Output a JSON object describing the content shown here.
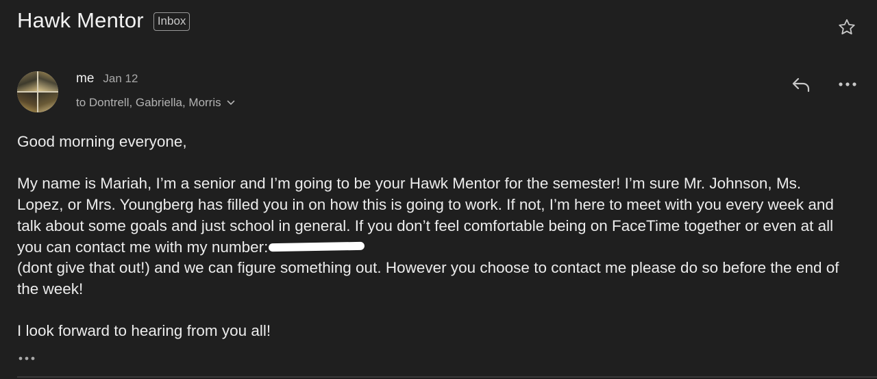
{
  "header": {
    "subject": "Hawk Mentor",
    "label": "Inbox",
    "star_icon": "star-outline-icon"
  },
  "message": {
    "sender": "me",
    "date": "Jan 12",
    "recipients": "to Dontrell, Gabriella, Morris",
    "avatar": "profile-photo-collage",
    "actions": {
      "reply_icon": "reply-icon",
      "more_icon": "more-horizontal-icon"
    },
    "body": {
      "greeting": "Good morning everyone,",
      "paragraph1_before_redaction": "My name is Mariah, I’m a senior and I’m going to be your Hawk Mentor for the semester! I’m sure Mr. Johnson, Ms. Lopez, or Mrs. Youngberg has filled you in on how this is going to work. If not, I’m here to meet with you every week and talk about some goals  and just school in general. If you don’t feel comfortable being on FaceTime together or even at all you can contact me with my number:",
      "paragraph1_after_redaction": "(dont give that out!) and we can figure something out. However you choose to contact me please do so before the end of the week!",
      "closing": "I look forward to hearing from you all!"
    },
    "trimmed_content_icon": "ellipsis-icon"
  },
  "colors": {
    "background": "#1f1f1f",
    "text_primary": "#ececec",
    "text_secondary": "#a9a9a9",
    "icon": "#c8c8c8"
  }
}
